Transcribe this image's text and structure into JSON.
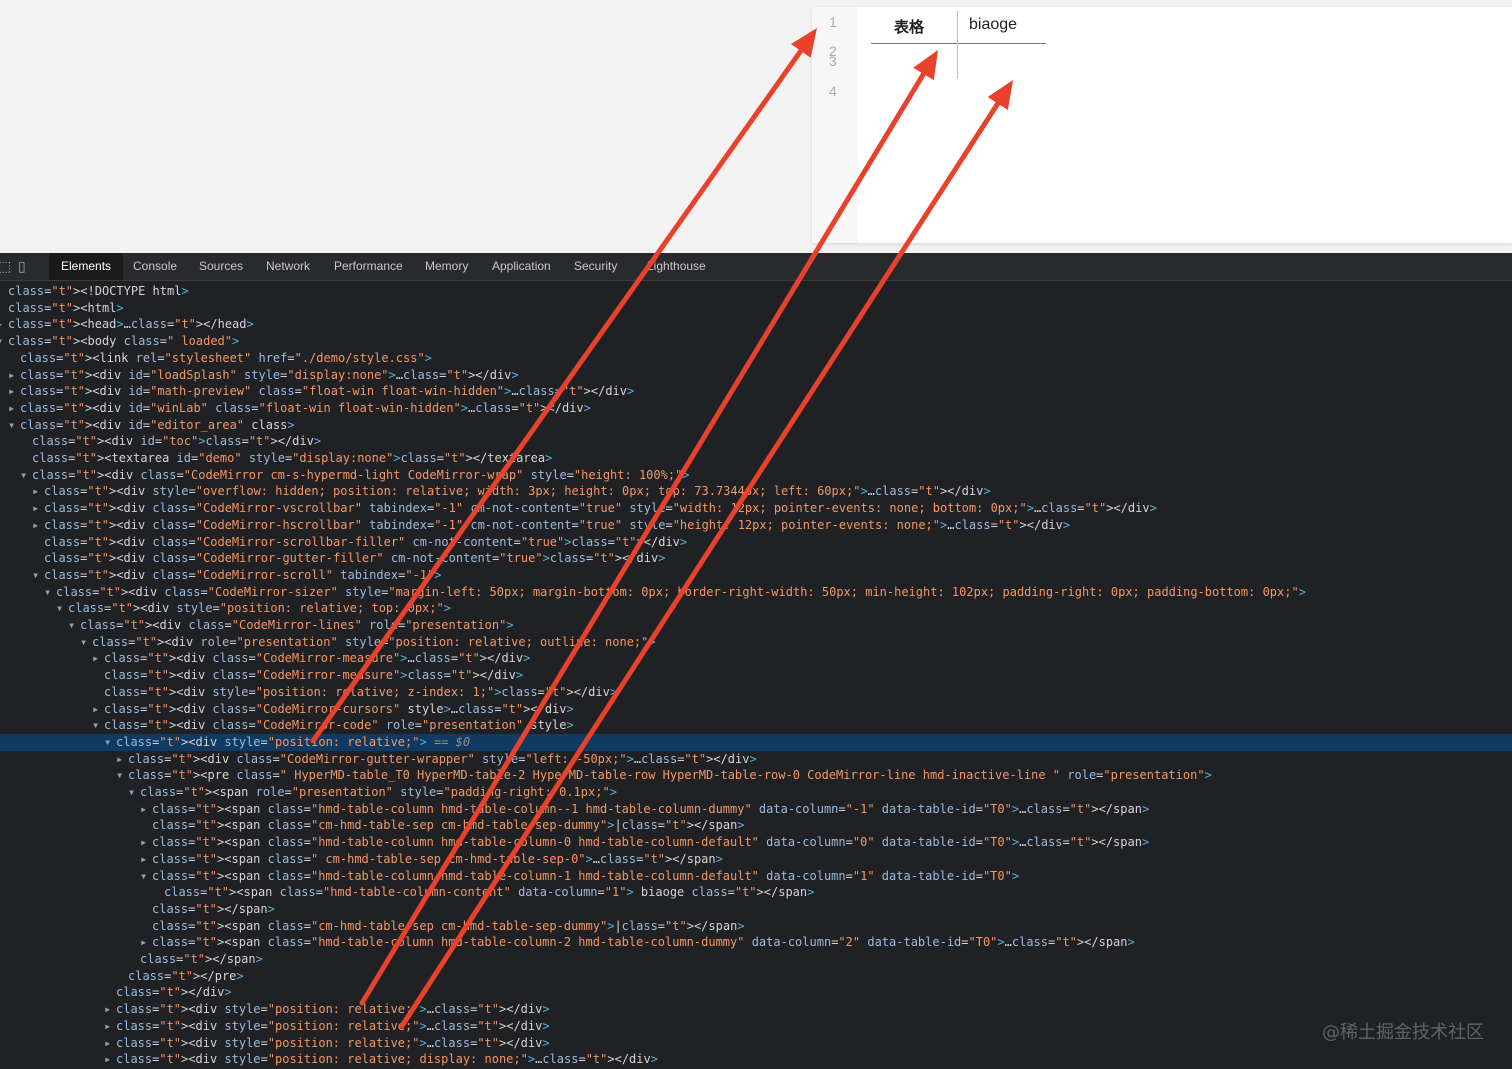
{
  "editor": {
    "line_numbers": [
      "1",
      "2",
      "3",
      "4"
    ],
    "table_header_1": "表格",
    "table_header_2": "biaoge"
  },
  "devtools": {
    "tabs": [
      {
        "label": "Elements",
        "active": true
      },
      {
        "label": "Console"
      },
      {
        "label": "Sources"
      },
      {
        "label": "Network"
      },
      {
        "label": "Performance"
      },
      {
        "label": "Memory"
      },
      {
        "label": "Application"
      },
      {
        "label": "Security"
      },
      {
        "label": "Lighthouse"
      }
    ],
    "dom_lines": [
      {
        "indent": 0,
        "text": "<!DOCTYPE html>"
      },
      {
        "indent": 0,
        "text": "<html>"
      },
      {
        "indent": 0,
        "tri": "▸",
        "text": "<head>…</head>"
      },
      {
        "indent": 0,
        "tri": "▾",
        "text": "<body class=\" loaded\">"
      },
      {
        "indent": 1,
        "text": "<link rel=\"stylesheet\" href=\"./demo/style.css\">"
      },
      {
        "indent": 1,
        "tri": "▸",
        "text": "<div id=\"loadSplash\" style=\"display:none\">…</div>"
      },
      {
        "indent": 1,
        "tri": "▸",
        "text": "<div id=\"math-preview\" class=\"float-win float-win-hidden\">…</div>"
      },
      {
        "indent": 1,
        "tri": "▸",
        "text": "<div id=\"winLab\" class=\"float-win float-win-hidden\">…</div>"
      },
      {
        "indent": 1,
        "tri": "▾",
        "text": "<div id=\"editor_area\" class>"
      },
      {
        "indent": 2,
        "text": "<div id=\"toc\"></div>"
      },
      {
        "indent": 2,
        "text": "<textarea id=\"demo\" style=\"display:none\"></textarea>"
      },
      {
        "indent": 2,
        "tri": "▾",
        "text": "<div class=\"CodeMirror cm-s-hypermd-light CodeMirror-wrap\" style=\"height: 100%;\">"
      },
      {
        "indent": 3,
        "tri": "▸",
        "text": "<div style=\"overflow: hidden; position: relative; width: 3px; height: 0px; top: 73.7344px; left: 60px;\">…</div>"
      },
      {
        "indent": 3,
        "tri": "▸",
        "text": "<div class=\"CodeMirror-vscrollbar\" tabindex=\"-1\" cm-not-content=\"true\" style=\"width: 12px; pointer-events: none; bottom: 0px;\">…</div>"
      },
      {
        "indent": 3,
        "tri": "▸",
        "text": "<div class=\"CodeMirror-hscrollbar\" tabindex=\"-1\" cm-not-content=\"true\" style=\"height: 12px; pointer-events: none;\">…</div>"
      },
      {
        "indent": 3,
        "text": "<div class=\"CodeMirror-scrollbar-filler\" cm-not-content=\"true\"></div>"
      },
      {
        "indent": 3,
        "text": "<div class=\"CodeMirror-gutter-filler\" cm-not-content=\"true\"></div>"
      },
      {
        "indent": 3,
        "tri": "▾",
        "text": "<div class=\"CodeMirror-scroll\" tabindex=\"-1\">"
      },
      {
        "indent": 4,
        "tri": "▾",
        "text": "<div class=\"CodeMirror-sizer\" style=\"margin-left: 50px; margin-bottom: 0px; border-right-width: 50px; min-height: 102px; padding-right: 0px; padding-bottom: 0px;\">"
      },
      {
        "indent": 5,
        "tri": "▾",
        "text": "<div style=\"position: relative; top: 0px;\">"
      },
      {
        "indent": 6,
        "tri": "▾",
        "text": "<div class=\"CodeMirror-lines\" role=\"presentation\">"
      },
      {
        "indent": 7,
        "tri": "▾",
        "text": "<div role=\"presentation\" style=\"position: relative; outline: none;\">"
      },
      {
        "indent": 8,
        "tri": "▸",
        "text": "<div class=\"CodeMirror-measure\">…</div>"
      },
      {
        "indent": 8,
        "text": "<div class=\"CodeMirror-measure\"></div>"
      },
      {
        "indent": 8,
        "text": "<div style=\"position: relative; z-index: 1;\"></div>"
      },
      {
        "indent": 8,
        "tri": "▸",
        "text": "<div class=\"CodeMirror-cursors\" style>…</div>"
      },
      {
        "indent": 8,
        "tri": "▾",
        "text": "<div class=\"CodeMirror-code\" role=\"presentation\" style>"
      },
      {
        "indent": 9,
        "tri": "▾",
        "text": "<div style=\"position: relative;\">",
        "selected": true,
        "suffix": " == $0"
      },
      {
        "indent": 10,
        "tri": "▸",
        "text": "<div class=\"CodeMirror-gutter-wrapper\" style=\"left: -50px;\">…</div>"
      },
      {
        "indent": 10,
        "tri": "▾",
        "text": "<pre class=\" HyperMD-table_T0 HyperMD-table-2 HyperMD-table-row HyperMD-table-row-0 CodeMirror-line hmd-inactive-line \" role=\"presentation\">"
      },
      {
        "indent": 11,
        "tri": "▾",
        "text": "<span role=\"presentation\" style=\"padding-right: 0.1px;\">"
      },
      {
        "indent": 12,
        "tri": "▸",
        "text": "<span class=\"hmd-table-column hmd-table-column--1 hmd-table-column-dummy\" data-column=\"-1\" data-table-id=\"T0\">…</span>"
      },
      {
        "indent": 12,
        "text": "<span class=\"cm-hmd-table-sep cm-hmd-table-sep-dummy\">|</span>"
      },
      {
        "indent": 12,
        "tri": "▸",
        "text": "<span class=\"hmd-table-column hmd-table-column-0 hmd-table-column-default\" data-column=\"0\" data-table-id=\"T0\">…</span>"
      },
      {
        "indent": 12,
        "tri": "▸",
        "text": "<span class=\" cm-hmd-table-sep cm-hmd-table-sep-0\">…</span>"
      },
      {
        "indent": 12,
        "tri": "▾",
        "text": "<span class=\"hmd-table-column hmd-table-column-1 hmd-table-column-default\" data-column=\"1\" data-table-id=\"T0\">"
      },
      {
        "indent": 13,
        "text": "<span class=\"hmd-table-column-content\" data-column=\"1\"> biaoge </span>"
      },
      {
        "indent": 12,
        "text": "</span>"
      },
      {
        "indent": 12,
        "text": "<span class=\"cm-hmd-table-sep cm-hmd-table-sep-dummy\">|</span>"
      },
      {
        "indent": 12,
        "tri": "▸",
        "text": "<span class=\"hmd-table-column hmd-table-column-2 hmd-table-column-dummy\" data-column=\"2\" data-table-id=\"T0\">…</span>"
      },
      {
        "indent": 11,
        "text": "</span>"
      },
      {
        "indent": 10,
        "text": "</pre>"
      },
      {
        "indent": 9,
        "text": "</div>"
      },
      {
        "indent": 9,
        "tri": "▸",
        "text": "<div style=\"position: relative;\">…</div>"
      },
      {
        "indent": 9,
        "tri": "▸",
        "text": "<div style=\"position: relative;\">…</div>"
      },
      {
        "indent": 9,
        "tri": "▸",
        "text": "<div style=\"position: relative;\">…</div>"
      },
      {
        "indent": 9,
        "tri": "▸",
        "text": "<div style=\"position: relative; display: none;\">…</div>"
      }
    ]
  },
  "watermark": "@稀土掘金技术社区",
  "colors": {
    "arrow": "#e8412c",
    "devtools_bg": "#202124",
    "selected_row": "#113a62"
  }
}
